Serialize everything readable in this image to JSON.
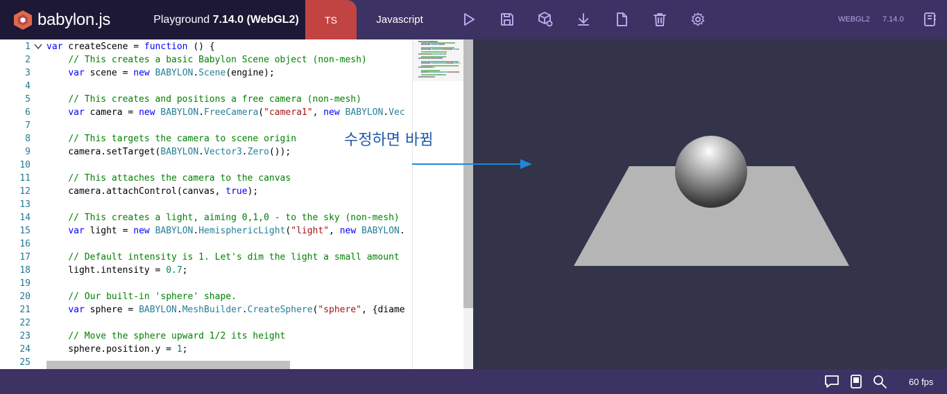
{
  "header": {
    "logo_text": "babylon.js",
    "title_prefix": "Playground ",
    "title_version": "7.14.0",
    "title_engine": " (WebGL2)",
    "tabs": [
      {
        "label": "TS",
        "active": true
      },
      {
        "label": "Javascript",
        "active": false
      }
    ],
    "tools": [
      "play-icon",
      "save-icon",
      "inspector-icon",
      "download-icon",
      "new-file-icon",
      "clear-icon",
      "settings-icon"
    ],
    "engine_label": "WEBGL2",
    "version_label": "7.14.0",
    "examples_icon": "book-icon"
  },
  "editor": {
    "lines": [
      {
        "n": "1",
        "tokens": [
          [
            "kw",
            "var"
          ],
          [
            "pl",
            " createScene = "
          ],
          [
            "kw",
            "function"
          ],
          [
            "pl",
            " () {"
          ]
        ]
      },
      {
        "n": "2",
        "tokens": [
          [
            "pl",
            "    "
          ],
          [
            "cm",
            "// This creates a basic Babylon Scene object (non-mesh)"
          ]
        ]
      },
      {
        "n": "3",
        "tokens": [
          [
            "pl",
            "    "
          ],
          [
            "kw",
            "var"
          ],
          [
            "pl",
            " scene = "
          ],
          [
            "kw",
            "new"
          ],
          [
            "pl",
            " "
          ],
          [
            "cl",
            "BABYLON"
          ],
          [
            "pl",
            "."
          ],
          [
            "cl",
            "Scene"
          ],
          [
            "pl",
            "(engine);"
          ]
        ]
      },
      {
        "n": "4",
        "tokens": []
      },
      {
        "n": "5",
        "tokens": [
          [
            "pl",
            "    "
          ],
          [
            "cm",
            "// This creates and positions a free camera (non-mesh)"
          ]
        ]
      },
      {
        "n": "6",
        "tokens": [
          [
            "pl",
            "    "
          ],
          [
            "kw",
            "var"
          ],
          [
            "pl",
            " camera = "
          ],
          [
            "kw",
            "new"
          ],
          [
            "pl",
            " "
          ],
          [
            "cl",
            "BABYLON"
          ],
          [
            "pl",
            "."
          ],
          [
            "cl",
            "FreeCamera"
          ],
          [
            "pl",
            "("
          ],
          [
            "st",
            "\"camera1\""
          ],
          [
            "pl",
            ", "
          ],
          [
            "kw",
            "new"
          ],
          [
            "pl",
            " "
          ],
          [
            "cl",
            "BABYLON"
          ],
          [
            "pl",
            "."
          ],
          [
            "cl",
            "Vec"
          ]
        ]
      },
      {
        "n": "7",
        "tokens": []
      },
      {
        "n": "8",
        "tokens": [
          [
            "pl",
            "    "
          ],
          [
            "cm",
            "// This targets the camera to scene origin"
          ]
        ]
      },
      {
        "n": "9",
        "tokens": [
          [
            "pl",
            "    camera.setTarget("
          ],
          [
            "cl",
            "BABYLON"
          ],
          [
            "pl",
            "."
          ],
          [
            "cl",
            "Vector3"
          ],
          [
            "pl",
            "."
          ],
          [
            "cl",
            "Zero"
          ],
          [
            "pl",
            "());"
          ]
        ]
      },
      {
        "n": "10",
        "tokens": []
      },
      {
        "n": "11",
        "tokens": [
          [
            "pl",
            "    "
          ],
          [
            "cm",
            "// This attaches the camera to the canvas"
          ]
        ]
      },
      {
        "n": "12",
        "tokens": [
          [
            "pl",
            "    camera.attachControl(canvas, "
          ],
          [
            "kw",
            "true"
          ],
          [
            "pl",
            ");"
          ]
        ]
      },
      {
        "n": "13",
        "tokens": []
      },
      {
        "n": "14",
        "tokens": [
          [
            "pl",
            "    "
          ],
          [
            "cm",
            "// This creates a light, aiming 0,1,0 - to the sky (non-mesh)"
          ]
        ]
      },
      {
        "n": "15",
        "tokens": [
          [
            "pl",
            "    "
          ],
          [
            "kw",
            "var"
          ],
          [
            "pl",
            " light = "
          ],
          [
            "kw",
            "new"
          ],
          [
            "pl",
            " "
          ],
          [
            "cl",
            "BABYLON"
          ],
          [
            "pl",
            "."
          ],
          [
            "cl",
            "HemisphericLight"
          ],
          [
            "pl",
            "("
          ],
          [
            "st",
            "\"light\""
          ],
          [
            "pl",
            ", "
          ],
          [
            "kw",
            "new"
          ],
          [
            "pl",
            " "
          ],
          [
            "cl",
            "BABYLON"
          ],
          [
            "pl",
            "."
          ]
        ]
      },
      {
        "n": "16",
        "tokens": []
      },
      {
        "n": "17",
        "tokens": [
          [
            "pl",
            "    "
          ],
          [
            "cm",
            "// Default intensity is 1. Let's dim the light a small amount"
          ]
        ]
      },
      {
        "n": "18",
        "tokens": [
          [
            "pl",
            "    light.intensity = "
          ],
          [
            "nm",
            "0.7"
          ],
          [
            "pl",
            ";"
          ]
        ]
      },
      {
        "n": "19",
        "tokens": []
      },
      {
        "n": "20",
        "tokens": [
          [
            "pl",
            "    "
          ],
          [
            "cm",
            "// Our built-in 'sphere' shape."
          ]
        ]
      },
      {
        "n": "21",
        "tokens": [
          [
            "pl",
            "    "
          ],
          [
            "kw",
            "var"
          ],
          [
            "pl",
            " sphere = "
          ],
          [
            "cl",
            "BABYLON"
          ],
          [
            "pl",
            "."
          ],
          [
            "cl",
            "MeshBuilder"
          ],
          [
            "pl",
            "."
          ],
          [
            "cl",
            "CreateSphere"
          ],
          [
            "pl",
            "("
          ],
          [
            "st",
            "\"sphere\""
          ],
          [
            "pl",
            ", {diame"
          ]
        ]
      },
      {
        "n": "22",
        "tokens": []
      },
      {
        "n": "23",
        "tokens": [
          [
            "pl",
            "    "
          ],
          [
            "cm",
            "// Move the sphere upward 1/2 its height"
          ]
        ]
      },
      {
        "n": "24",
        "tokens": [
          [
            "pl",
            "    sphere.position.y = "
          ],
          [
            "nm",
            "1"
          ],
          [
            "pl",
            ";"
          ]
        ]
      },
      {
        "n": "25",
        "tokens": []
      }
    ]
  },
  "annotation": {
    "text": "수정하면 바뀜",
    "color": "#1e5aa8",
    "arrow_color": "#1e88d8"
  },
  "footer": {
    "icons": [
      "feedback-icon",
      "docs-icon",
      "search-icon"
    ],
    "fps_label": "60 fps"
  },
  "colors": {
    "header_bg": "#3c3263",
    "header_dark": "#1c1836",
    "ts_tab": "#c14443",
    "canvas_bg": "#333349",
    "icon": "#b4a8ea"
  }
}
